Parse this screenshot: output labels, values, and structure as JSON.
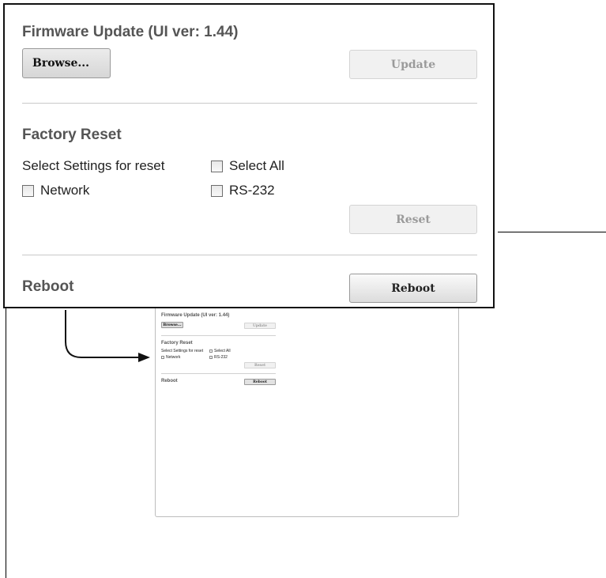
{
  "firmware": {
    "title": "Firmware Update (UI ver: 1.44)",
    "browse_label": "Browse...",
    "update_label": "Update"
  },
  "factory_reset": {
    "title": "Factory Reset",
    "select_label": "Select Settings for reset",
    "select_all_label": "Select All",
    "network_label": "Network",
    "rs232_label": "RS-232",
    "reset_label": "Reset"
  },
  "reboot": {
    "title": "Reboot",
    "button_label": "Reboot"
  }
}
